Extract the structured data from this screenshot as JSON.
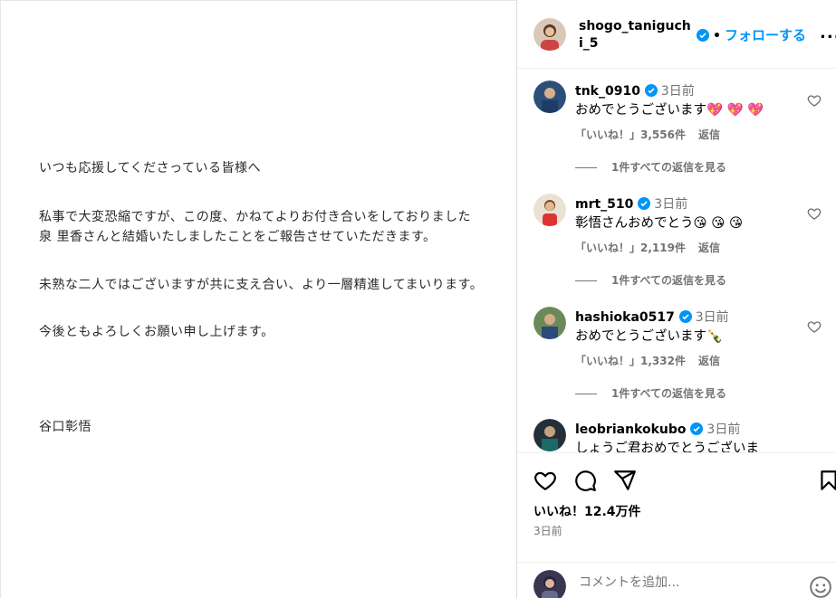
{
  "letter": {
    "greeting": "いつも応援してくださっている皆様へ",
    "line1": "私事で大変恐縮ですが、この度、かねてよりお付き合いをしておりました",
    "line2": "泉 里香さんと結婚いたしましたことをご報告させていただきます。",
    "line3": "未熟な二人ではございますが共に支え合い、より一層精進してまいります。",
    "line4": "今後ともよろしくお願い申し上げます。",
    "signature": "谷口彰悟"
  },
  "header": {
    "username": "shogo_taniguchi_5",
    "follow_label": "フォローする",
    "more_label": "..."
  },
  "comments": [
    {
      "user": "tnk_0910",
      "time": "3日前",
      "text": "おめでとうございます💖 💖 💖",
      "likes": "「いいね！」3,556件",
      "reply_label": "返信",
      "view_replies": "1件すべての返信を見る"
    },
    {
      "user": "mrt_510",
      "time": "3日前",
      "text": "彰悟さんおめでとう😘 😘 😘",
      "likes": "「いいね！」2,119件",
      "reply_label": "返信",
      "view_replies": "1件すべての返信を見る"
    },
    {
      "user": "hashioka0517",
      "time": "3日前",
      "text": "おめでとうございます🍾",
      "likes": "「いいね！」1,332件",
      "reply_label": "返信",
      "view_replies": "1件すべての返信を見る"
    },
    {
      "user": "leobriankokubo",
      "time": "3日前",
      "text": "しょうご君おめでとうございま"
    }
  ],
  "actions": {
    "likes": "いいね！12.4万件",
    "post_time": "3日前",
    "comment_placeholder": "コメントを追加..."
  },
  "colors": {
    "accent": "#0095f6",
    "muted": "#737373"
  }
}
